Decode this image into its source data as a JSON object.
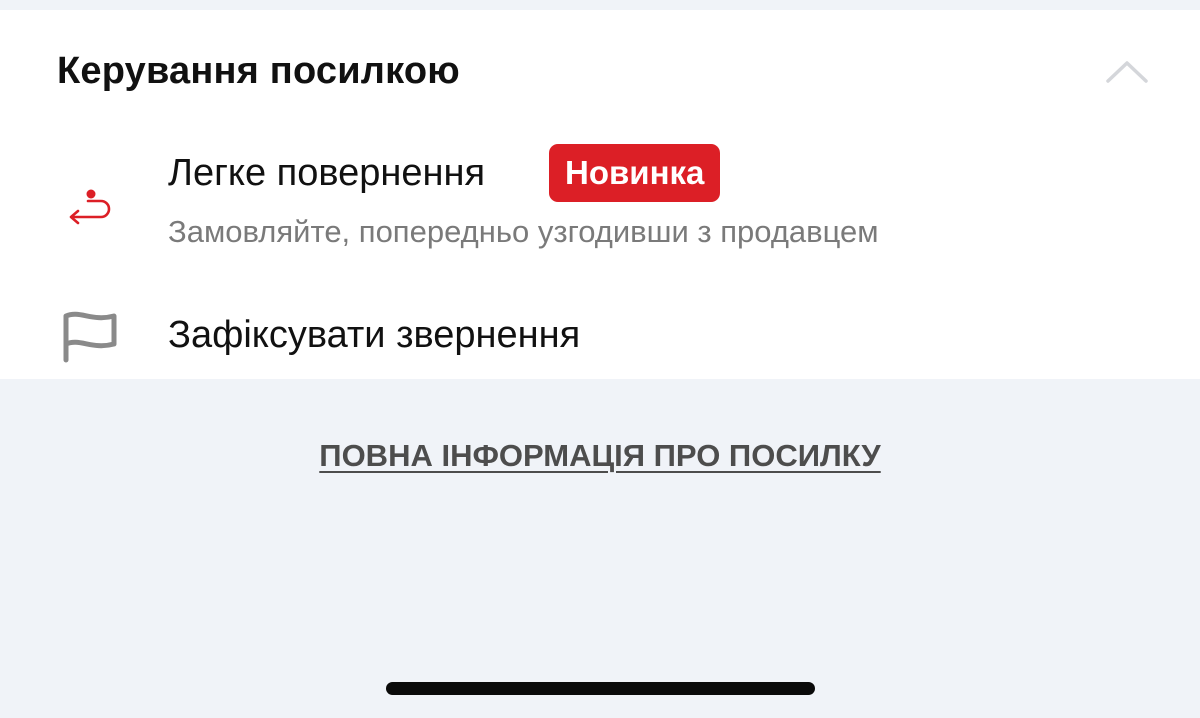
{
  "section": {
    "title": "Керування посилкою",
    "collapse_icon": "chevron-up-icon"
  },
  "items": [
    {
      "icon": "return-arrow-icon",
      "title": "Легке повернення",
      "badge": "Новинка",
      "subtitle": "Замовляйте, попередньо узгодивши з продавцем"
    },
    {
      "icon": "flag-icon",
      "title": "Зафіксувати звернення"
    }
  ],
  "footer": {
    "link_label": "ПОВНА ІНФОРМАЦІЯ ПРО ПОСИЛКУ"
  },
  "colors": {
    "accent": "#dc1f26",
    "background": "#f0f3f8",
    "card": "#ffffff",
    "muted_text": "#7a7a7a",
    "icon_gray": "#8a8a8a"
  }
}
